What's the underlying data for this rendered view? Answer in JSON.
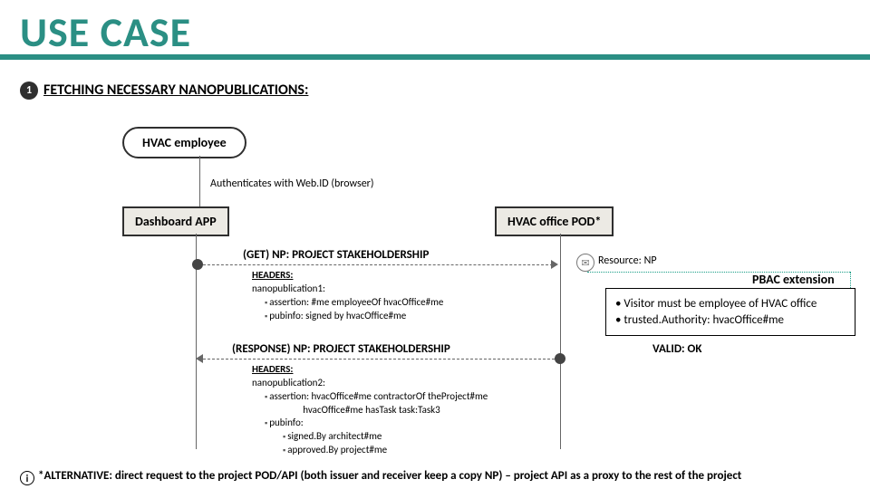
{
  "title": "USE CASE",
  "step": {
    "num": "1",
    "label": "FETCHING NECESSARY NANOPUBLICATIONS:"
  },
  "actor": "HVAC employee",
  "auth_text": "Authenticates with Web.ID (browser)",
  "dashboard": "Dashboard APP",
  "pod": "HVAC office POD*",
  "msg1": {
    "title": "(GET) NP: PROJECT STAKEHOLDERSHIP",
    "headers_label": "HEADERS:",
    "np_label": "nanopublication1:",
    "b1": "assertion: #me employeeOf hvacOffice#me",
    "b2": "pubinfo: signed by hvacOffice#me"
  },
  "resource": "Resource: NP",
  "pbac_label": "PBAC extension",
  "pbac": {
    "b1": "Visitor must be employee of HVAC office",
    "b2": "trusted.Authority: hvacOffice#me"
  },
  "msg2": {
    "title": "(RESPONSE) NP: PROJECT STAKEHOLDERSHIP",
    "headers_label": "HEADERS:",
    "np_label": "nanopublication2:",
    "b1": "assertion: hvacOffice#me contractorOf theProject#me",
    "b1b": "hvacOffice#me hasTask task:Task3",
    "b2": "pubinfo:",
    "b2a": "signed.By architect#me",
    "b2b": "approved.By project#me"
  },
  "valid": "VALID: OK",
  "footer": "*ALTERNATIVE: direct request to the project POD/API (both issuer and receiver keep a copy NP) – project API as a proxy to the rest of the project"
}
